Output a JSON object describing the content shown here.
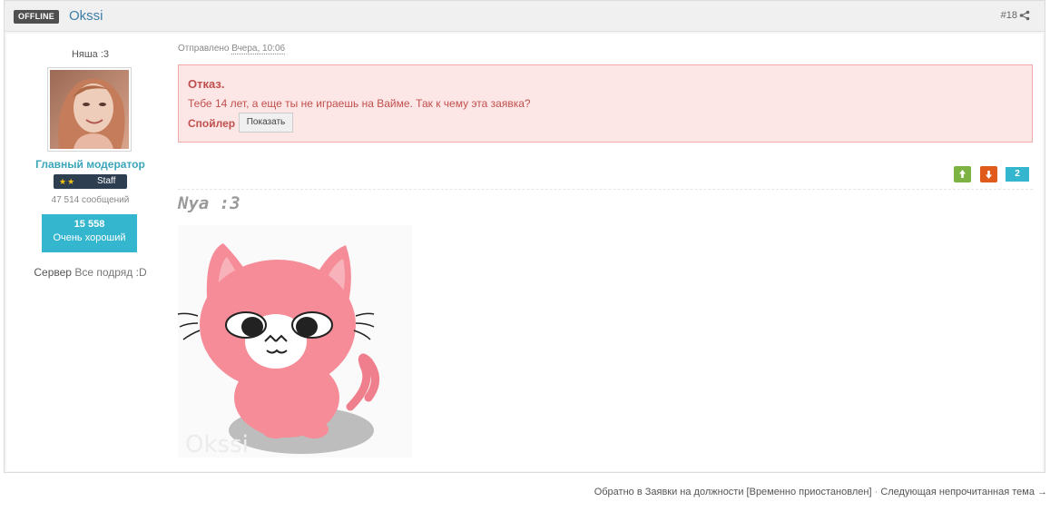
{
  "header": {
    "status_badge": "OFFLINE",
    "author": "Okssi",
    "post_number": "#18"
  },
  "user": {
    "title": "Няша :3",
    "role": "Главный модератор",
    "badge_label": "Staff",
    "messages": "47 514 сообщений",
    "reputation_value": "15 558",
    "reputation_label": "Очень хороший",
    "server_label": "Сервер",
    "server_value": "Все подряд :D"
  },
  "post": {
    "sent_label": "Отправлено",
    "sent_date": "Вчера, 10:06",
    "reject_title": "Отказ.",
    "reject_text": "Тебе 14 лет, а еще ты не играешь на Вайме. Так к чему эта заявка?",
    "spoiler_label": "Спойлер",
    "spoiler_button": "Показать",
    "vote_count": "2",
    "signature_text": "Nya :3",
    "signature_watermark": "Okssi"
  },
  "footer": {
    "back_link": "Обратно в Заявки на должности [Временно приостановлен]",
    "separator": "·",
    "next_link": "Следующая непрочитанная тема →"
  },
  "colors": {
    "accent": "#35b6cf",
    "reject_bg": "#fde6e6",
    "reject_text": "#c0504d",
    "vote_up": "#7cb342",
    "vote_down": "#e05a1c"
  }
}
